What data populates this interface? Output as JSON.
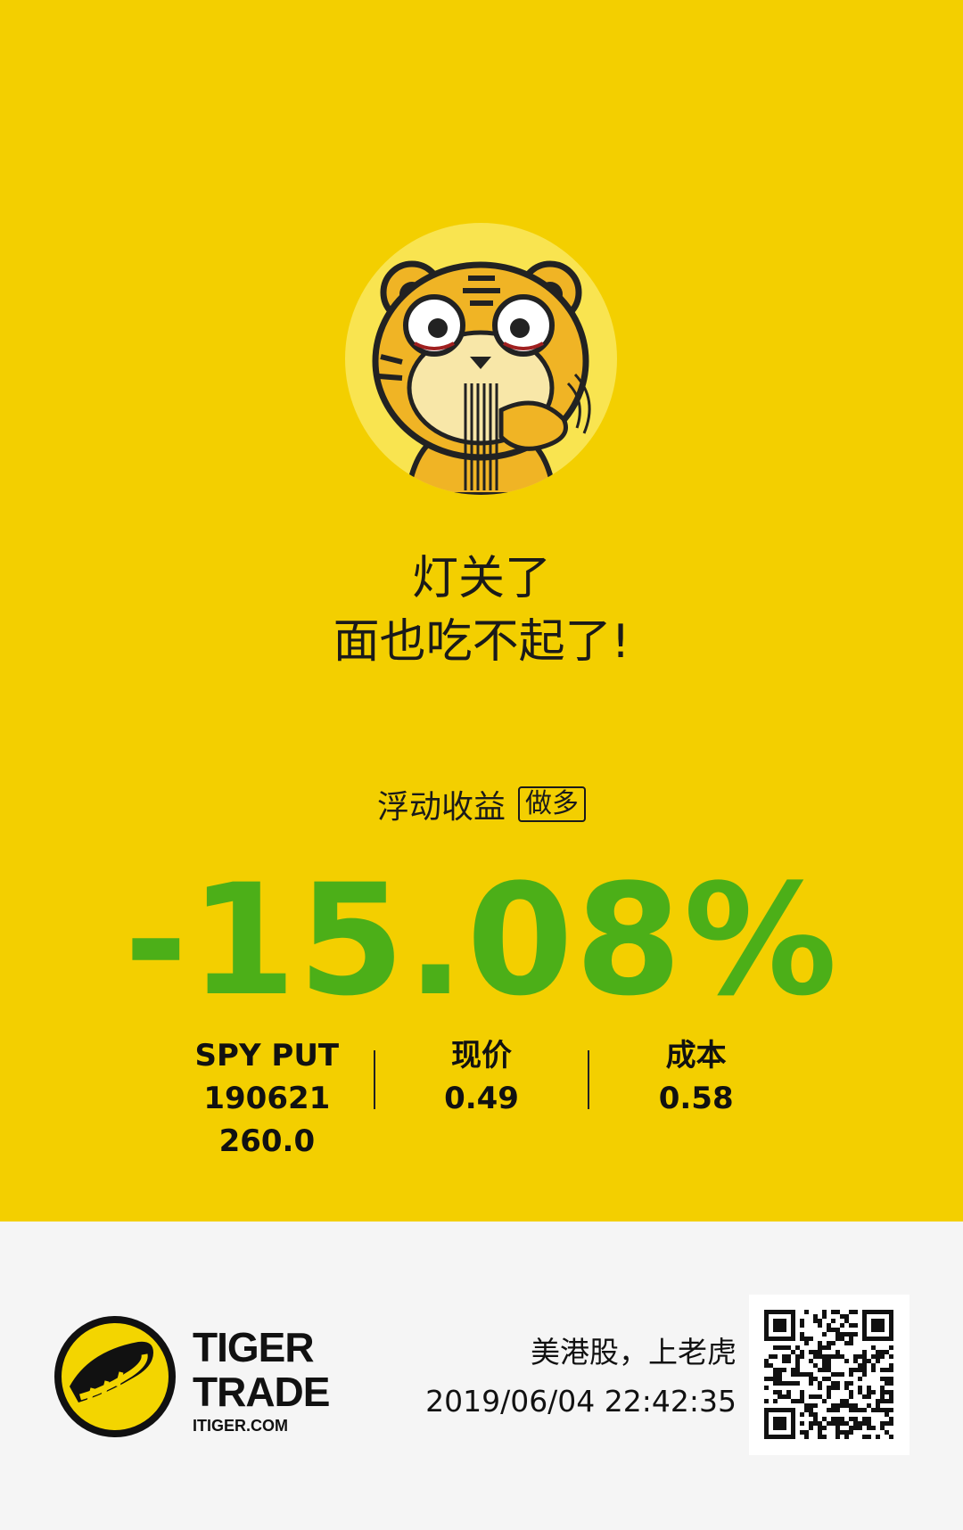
{
  "slogan": {
    "line1": "灯关了",
    "line2": "面也吃不起了!"
  },
  "profit": {
    "label": "浮动收益",
    "tag": "做多",
    "percent": "-15.08%",
    "color": "#4caf18"
  },
  "stats": {
    "symbol_line1": "SPY PUT",
    "symbol_line2": "190621 260.0",
    "price_label": "现价",
    "price_value": "0.49",
    "cost_label": "成本",
    "cost_value": "0.58"
  },
  "brand": {
    "line1": "TIGER",
    "line2": "TRADE",
    "site": "ITIGER.COM"
  },
  "promo": {
    "slogan": "美港股，上老虎",
    "timestamp": "2019/06/04 22:42:35"
  },
  "colors": {
    "background": "#f3cf00",
    "footer": "#f5f5f5",
    "accent": "#4caf18"
  },
  "icons": {
    "avatar": "tiger-eating-noodles-icon",
    "logo": "tiger-trade-logo-icon",
    "qr": "qr-code-icon"
  }
}
